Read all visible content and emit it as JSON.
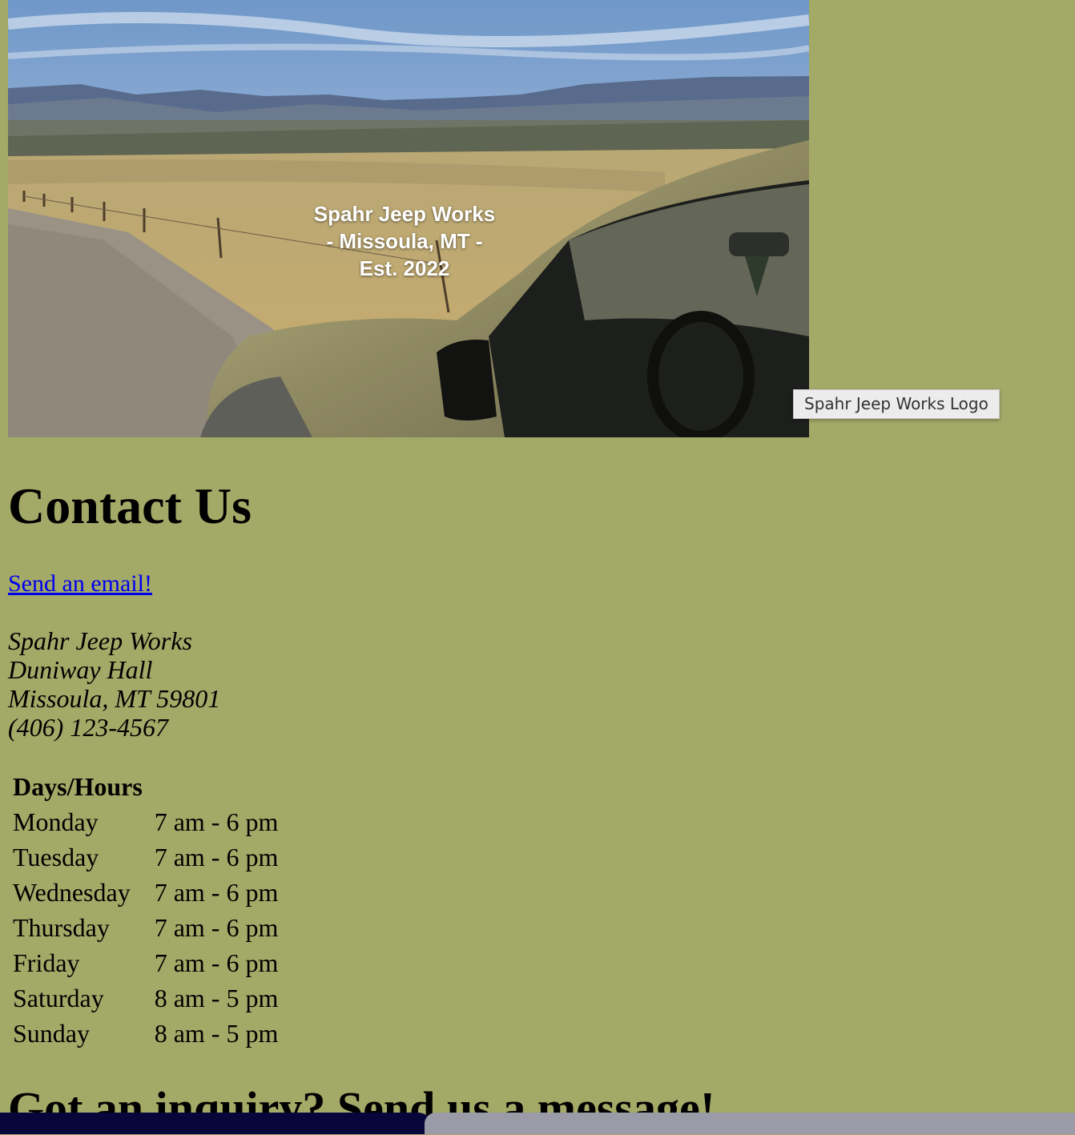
{
  "hero": {
    "image_name": "Spahr Jeep Works Logo",
    "caption_lines": [
      "Spahr Jeep Works",
      "- Missoula, MT -",
      "Est. 2022"
    ]
  },
  "tooltip": {
    "text": "Spahr Jeep Works Logo"
  },
  "contact": {
    "title": "Contact Us",
    "email_link": "Send an email!",
    "address": {
      "name": "Spahr Jeep Works",
      "building": "Duniway Hall",
      "city_line": "Missoula, MT 59801",
      "phone": "(406) 123-4567"
    }
  },
  "hours": {
    "header": "Days/Hours",
    "rows": [
      {
        "day": "Monday",
        "hours": "7 am - 6 pm"
      },
      {
        "day": "Tuesday",
        "hours": "7 am - 6 pm"
      },
      {
        "day": "Wednesday",
        "hours": "7 am - 6 pm"
      },
      {
        "day": "Thursday",
        "hours": "7 am - 6 pm"
      },
      {
        "day": "Friday",
        "hours": "7 am - 6 pm"
      },
      {
        "day": "Saturday",
        "hours": "8 am - 5 pm"
      },
      {
        "day": "Sunday",
        "hours": "8 am - 5 pm"
      }
    ]
  },
  "inquiry": {
    "title": "Got an inquiry? Send us a message!"
  },
  "colors": {
    "page_background": "#a3a967",
    "link": "#0000ee"
  }
}
